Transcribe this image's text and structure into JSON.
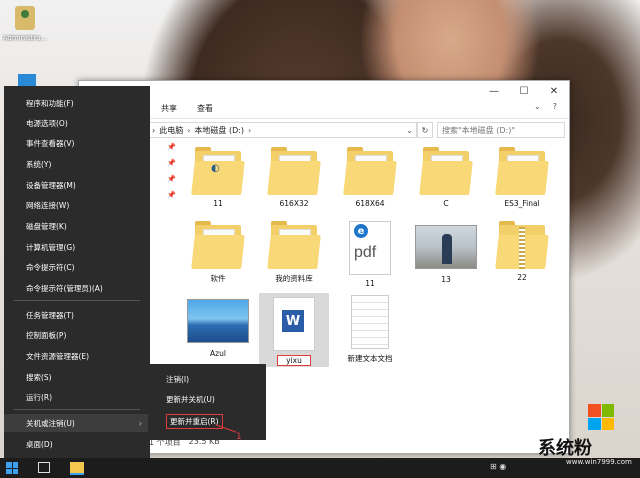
{
  "desktop": {
    "admin_icon_label": "Administra..."
  },
  "explorer": {
    "ribbon_tabs": [
      "共享",
      "查看"
    ],
    "breadcrumb": [
      "此电脑",
      "本地磁盘 (D:)"
    ],
    "search_placeholder": "搜索\"本地磁盘 (D:)\"",
    "items": [
      {
        "label": "11",
        "kind": "folder"
      },
      {
        "label": "616X32",
        "kind": "folder"
      },
      {
        "label": "618X64",
        "kind": "folder"
      },
      {
        "label": "C",
        "kind": "folder"
      },
      {
        "label": "ES3_Final",
        "kind": "folder"
      },
      {
        "label": "软件",
        "kind": "folder"
      },
      {
        "label": "我的资料库",
        "kind": "folder"
      },
      {
        "label": "11",
        "kind": "pdf"
      },
      {
        "label": "13",
        "kind": "photo"
      },
      {
        "label": "22",
        "kind": "zip"
      },
      {
        "label": "Azul",
        "kind": "image"
      },
      {
        "label": "yixu",
        "kind": "word"
      },
      {
        "label": "新建文本文档",
        "kind": "text"
      }
    ],
    "pdf_glyph": "pdf",
    "status": {
      "count": "1 个项目",
      "size": "23.5 KB"
    }
  },
  "context_menu": {
    "items": [
      "程序和功能(F)",
      "电源选项(O)",
      "事件查看器(V)",
      "系统(Y)",
      "设备管理器(M)",
      "网络连接(W)",
      "磁盘管理(K)",
      "计算机管理(G)",
      "命令提示符(C)",
      "命令提示符(管理员)(A)",
      "任务管理器(T)",
      "控制面板(P)",
      "文件资源管理器(E)",
      "搜索(S)",
      "运行(R)",
      "关机或注销(U)",
      "桌面(D)"
    ]
  },
  "submenu": {
    "items": [
      "注销(I)",
      "更新并关机(U)",
      "更新并重启(R)"
    ]
  },
  "annotation_number": "1",
  "watermark": {
    "text": "系统粉",
    "url": "www.win7999.com"
  },
  "colors": {
    "menu_bg": "#2b2b2b",
    "highlight_red": "#e03c3c",
    "folder_yellow": "#f8d877",
    "taskbar": "#1c1c1c"
  }
}
